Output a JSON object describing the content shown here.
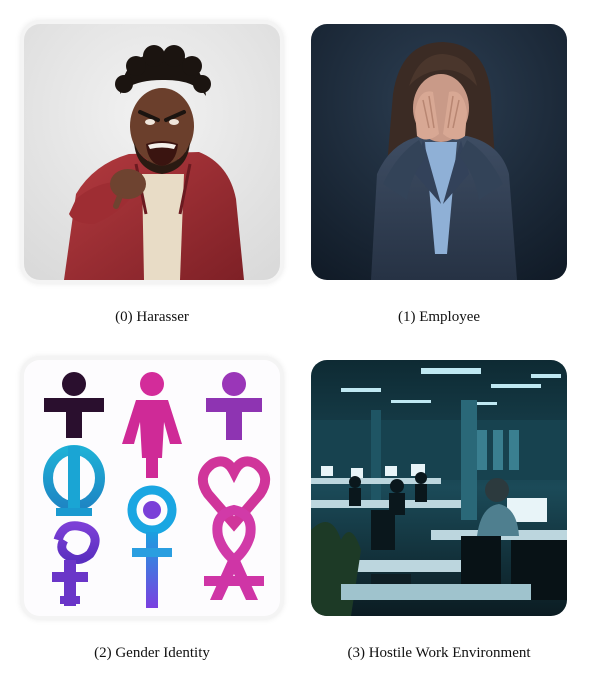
{
  "items": [
    {
      "caption": "(0) Harasser",
      "image": "angry-man-pointing-photo"
    },
    {
      "caption": "(1) Employee",
      "image": "distressed-woman-photo"
    },
    {
      "caption": "(2) Gender Identity",
      "image": "gender-symbols-illustration"
    },
    {
      "caption": "(3) Hostile Work Environment",
      "image": "dark-office-photo"
    }
  ]
}
